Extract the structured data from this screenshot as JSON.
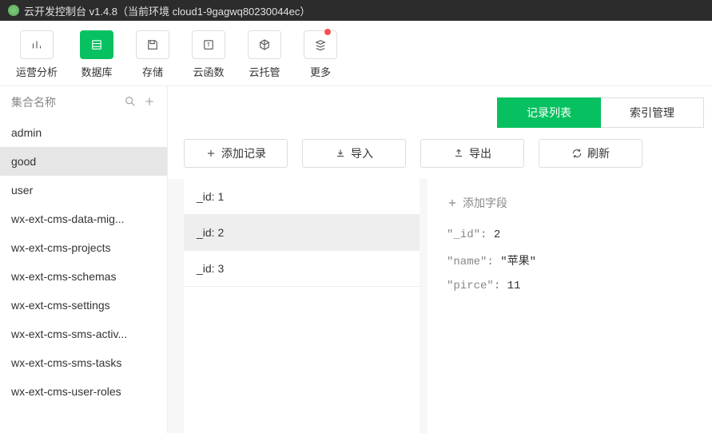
{
  "titlebar": {
    "text": "云开发控制台 v1.4.8（当前环境 cloud1-9gagwq80230044ec）"
  },
  "topnav": {
    "items": [
      {
        "label": "运营分析"
      },
      {
        "label": "数据库"
      },
      {
        "label": "存储"
      },
      {
        "label": "云函数"
      },
      {
        "label": "云托管"
      },
      {
        "label": "更多"
      }
    ]
  },
  "sidebar": {
    "header_label": "集合名称",
    "collections": [
      "admin",
      "good",
      "user",
      "wx-ext-cms-data-mig...",
      "wx-ext-cms-projects",
      "wx-ext-cms-schemas",
      "wx-ext-cms-settings",
      "wx-ext-cms-sms-activ...",
      "wx-ext-cms-sms-tasks",
      "wx-ext-cms-user-roles"
    ]
  },
  "tabs": {
    "records": "记录列表",
    "indexes": "索引管理"
  },
  "actions": {
    "add": "添加记录",
    "import": "导入",
    "export": "导出",
    "refresh": "刷新"
  },
  "records": [
    "_id: 1",
    "_id: 2",
    "_id: 3"
  ],
  "detail": {
    "add_field": "添加字段",
    "fields": [
      {
        "key": "\"_id\"",
        "val": "2",
        "type": "num"
      },
      {
        "key": "\"name\"",
        "val": "\"苹果\"",
        "type": "str"
      },
      {
        "key": "\"pirce\"",
        "val": "11",
        "type": "num"
      }
    ]
  }
}
